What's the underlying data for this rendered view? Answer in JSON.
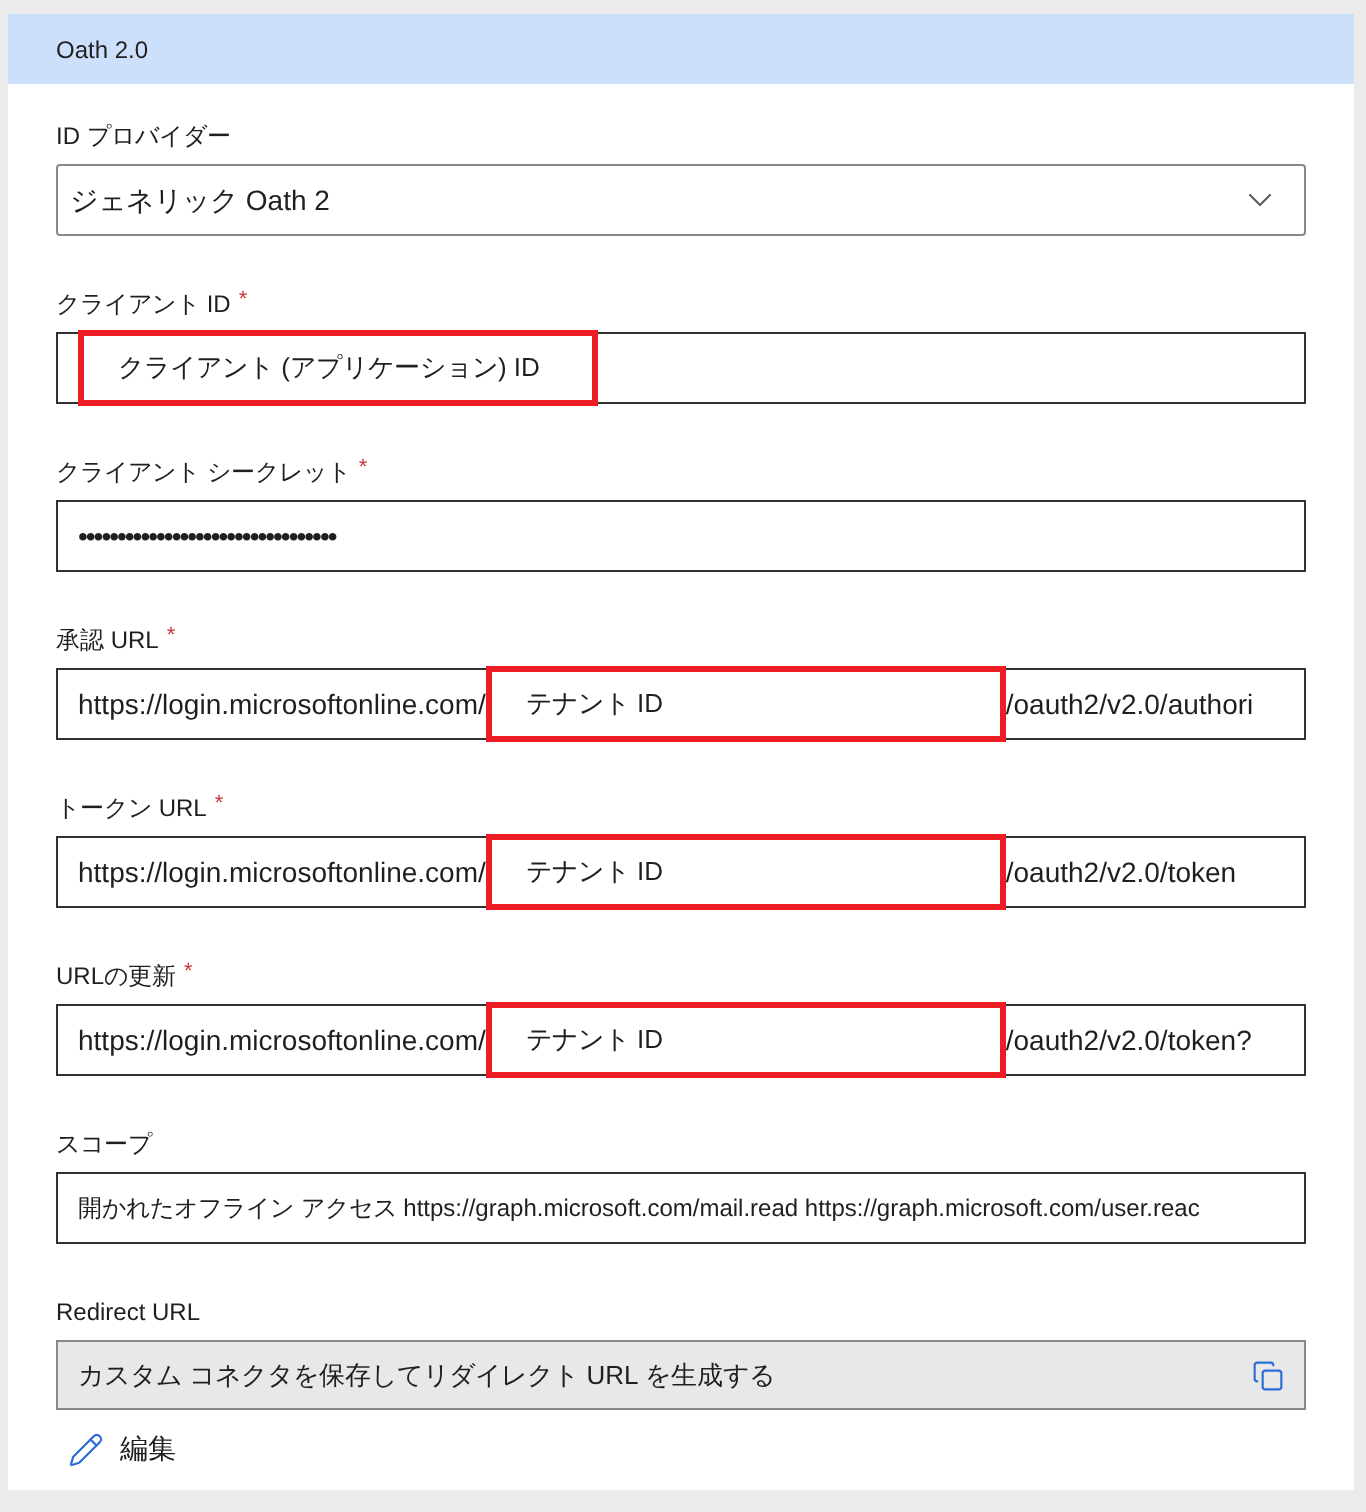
{
  "section": {
    "title": "Oath 2.0"
  },
  "fields": [
    {
      "kind": "select",
      "label": "ID プロバイダー",
      "value": "ジェネリック Oath 2"
    },
    {
      "kind": "segmented",
      "label": "クライアント ID",
      "required_mark": "*",
      "segments": [
        {
          "text": "クライアント (アプリケーション) ID",
          "highlighted": true
        }
      ]
    },
    {
      "kind": "password",
      "label": "クライアント シークレット",
      "required_mark": "*",
      "value": "•••••••••••••••••••••••••••••••••"
    },
    {
      "kind": "segmented",
      "label": "承認 URL",
      "required_mark": "*",
      "segments": [
        {
          "text": "https://login.microsoftonline.com/",
          "highlighted": false
        },
        {
          "text": "テナント ID",
          "highlighted": true
        },
        {
          "text": "/oauth2/v2.0/authori",
          "highlighted": false
        }
      ]
    },
    {
      "kind": "segmented",
      "label": "トークン URL",
      "required_mark": "*",
      "segments": [
        {
          "text": "https://login.microsoftonline.com/",
          "highlighted": false
        },
        {
          "text": "テナント ID",
          "highlighted": true
        },
        {
          "text": "/oauth2/v2.0/token",
          "highlighted": false
        }
      ]
    },
    {
      "kind": "segmented",
      "label": "URLの更新",
      "required_mark": "*",
      "segments": [
        {
          "text": "https://login.microsoftonline.com/",
          "highlighted": false
        },
        {
          "text": "テナント ID",
          "highlighted": true
        },
        {
          "text": "/oauth2/v2.0/token?",
          "highlighted": false
        }
      ]
    },
    {
      "kind": "text",
      "label": "スコープ",
      "value": "開かれたオフライン アクセス https://graph.microsoft.com/mail.read https://graph.microsoft.com/user.reac"
    },
    {
      "kind": "readonly",
      "label": "Redirect URL",
      "value": "カスタム コネクタを保存してリダイレクト URL を生成する"
    }
  ],
  "edit_button": {
    "label": "編集"
  }
}
